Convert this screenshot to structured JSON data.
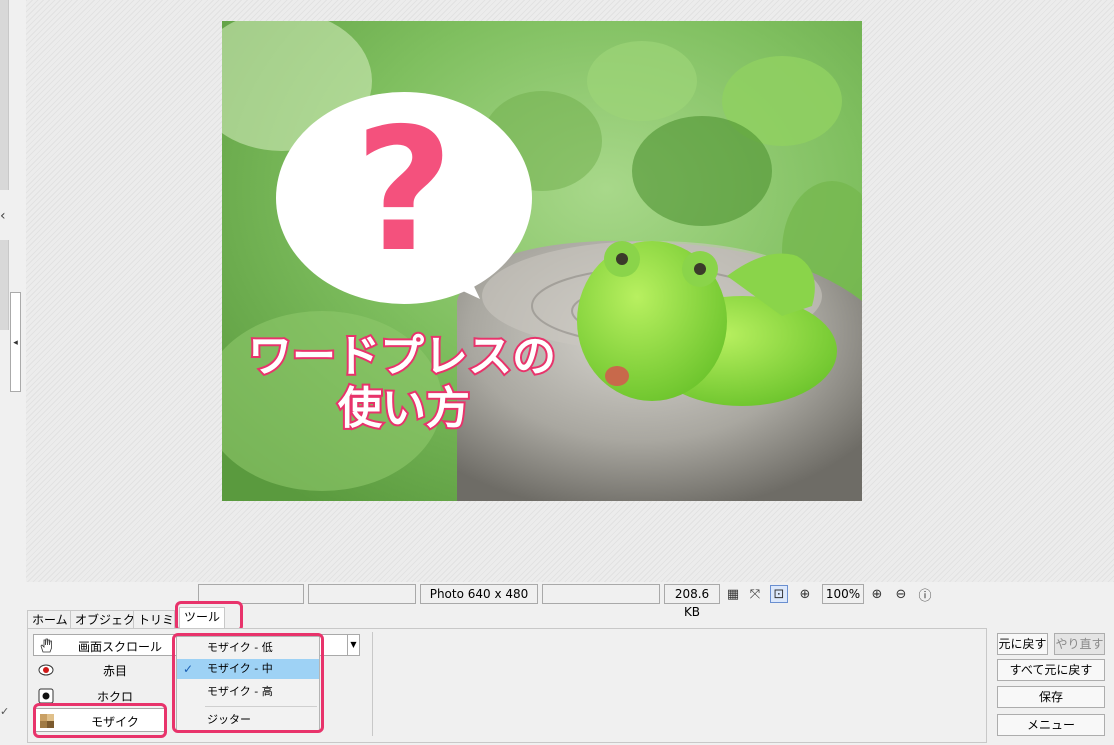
{
  "image": {
    "bubble_glyph": "?",
    "overlay_line1": "ワードプレスの",
    "overlay_line2": "使い方"
  },
  "status_bar": {
    "dimensions": "Photo 640 x 480",
    "file_size": "208.6 KB",
    "zoom": "100%"
  },
  "tabs": [
    {
      "label": "ホーム"
    },
    {
      "label": "オブジェクト"
    },
    {
      "label": "トリミング"
    },
    {
      "label": "ツール"
    }
  ],
  "tool_combo": {
    "value": "画面スクロール"
  },
  "tools": [
    {
      "label": "赤目"
    },
    {
      "label": "ホクロ"
    },
    {
      "label": "モザイク"
    }
  ],
  "dropdown": {
    "items": [
      {
        "label": "モザイク - 低"
      },
      {
        "label": "モザイク - 中"
      },
      {
        "label": "モザイク - 高"
      },
      {
        "label": "ジッター"
      }
    ],
    "selected_index": 1
  },
  "actions": {
    "undo": "元に戻す",
    "redo": "やり直す",
    "undo_all": "すべて元に戻す",
    "save": "保存",
    "menu": "メニュー"
  },
  "colors": {
    "highlight": "#e8336b",
    "menu_selected": "#9ed2f5"
  }
}
